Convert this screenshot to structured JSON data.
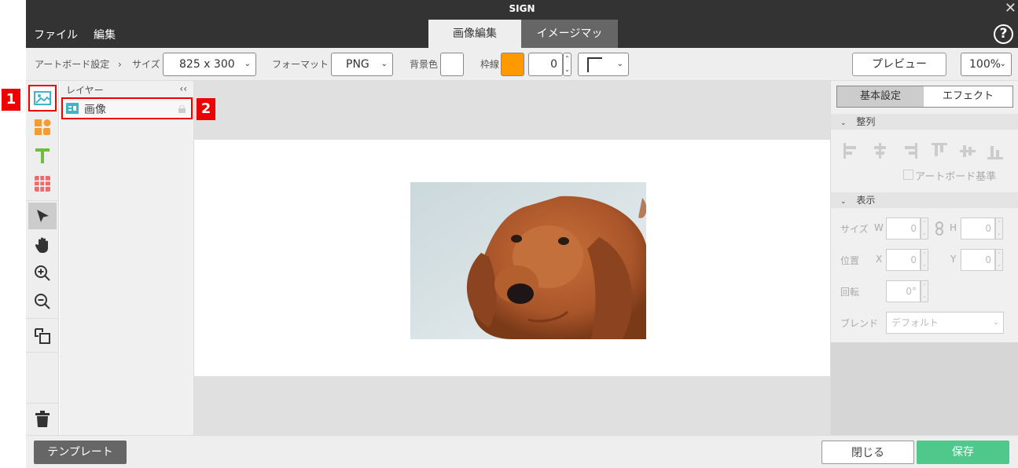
{
  "window": {
    "title": "SIGN",
    "close_symbol": "✕",
    "help_symbol": "?"
  },
  "menu": {
    "file": "ファイル",
    "edit": "編集"
  },
  "tabs": [
    {
      "label": "画像編集",
      "active": true
    },
    {
      "label": "イメージマップ",
      "active": false
    }
  ],
  "toolbar": {
    "artboard_label": "アートボード設定",
    "arrow": "›",
    "size_label": "サイズ",
    "size_value": "825 x 300",
    "format_label": "フォーマット",
    "format_value": "PNG",
    "bg_label": "背景色",
    "border_label": "枠線",
    "border_color": "#ff9900",
    "border_width": "0",
    "preview_label": "プレビュー",
    "zoom_value": "100%"
  },
  "layers": {
    "header": "レイヤー",
    "collapse_symbol": "‹‹",
    "items": [
      {
        "name": "画像"
      }
    ]
  },
  "annotations": {
    "one": "1",
    "two": "2"
  },
  "right_panel": {
    "tab_basic": "基本設定",
    "tab_effect": "エフェクト",
    "align_section": "整列",
    "artboard_basis": "アートボード基準",
    "display_section": "表示",
    "size_label": "サイズ",
    "w_label": "W",
    "w_value": "0",
    "h_label": "H",
    "h_value": "0",
    "position_label": "位置",
    "x_label": "X",
    "x_value": "0",
    "y_label": "Y",
    "y_value": "0",
    "rotation_label": "回転",
    "rotation_value": "0°",
    "blend_label": "ブレンド",
    "blend_value": "デフォルト"
  },
  "bottom": {
    "template": "テンプレート",
    "close": "閉じる",
    "save": "保存"
  },
  "colors": {
    "titlebar": "#333333",
    "accent_save": "#4ec98b",
    "highlight": "#e00000",
    "image_tool": "#3fb6c8",
    "shape_tool": "#f39c33",
    "text_tool": "#6cbf3e",
    "table_tool": "#ef6b6b"
  }
}
